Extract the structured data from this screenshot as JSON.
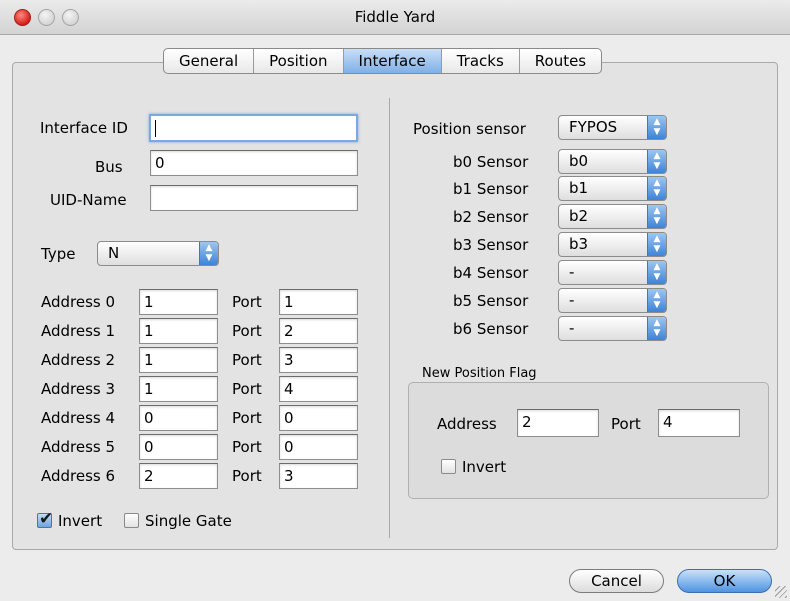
{
  "window": {
    "title": "Fiddle Yard"
  },
  "tabs": [
    "General",
    "Position",
    "Interface",
    "Tracks",
    "Routes"
  ],
  "active_tab": "Interface",
  "left": {
    "interface_id_label": "Interface ID",
    "interface_id_value": "",
    "bus_label": "Bus",
    "bus_value": "0",
    "uid_label": "UID-Name",
    "uid_value": "",
    "type_label": "Type",
    "type_value": "N",
    "port_label": "Port",
    "addresses": [
      {
        "label": "Address 0",
        "address": "1",
        "port": "1"
      },
      {
        "label": "Address 1",
        "address": "1",
        "port": "2"
      },
      {
        "label": "Address 2",
        "address": "1",
        "port": "3"
      },
      {
        "label": "Address 3",
        "address": "1",
        "port": "4"
      },
      {
        "label": "Address 4",
        "address": "0",
        "port": "0"
      },
      {
        "label": "Address 5",
        "address": "0",
        "port": "0"
      },
      {
        "label": "Address 6",
        "address": "2",
        "port": "3"
      }
    ],
    "invert_label": "Invert",
    "invert_checked": true,
    "single_gate_label": "Single Gate",
    "single_gate_checked": false
  },
  "right": {
    "position_sensor_label": "Position sensor",
    "position_sensor_value": "FYPOS",
    "sensors": [
      {
        "label": "b0 Sensor",
        "value": "b0"
      },
      {
        "label": "b1 Sensor",
        "value": "b1"
      },
      {
        "label": "b2 Sensor",
        "value": "b2"
      },
      {
        "label": "b3 Sensor",
        "value": "b3"
      },
      {
        "label": "b4 Sensor",
        "value": "-"
      },
      {
        "label": "b5 Sensor",
        "value": "-"
      },
      {
        "label": "b6 Sensor",
        "value": "-"
      }
    ],
    "new_position_flag": {
      "title": "New Position Flag",
      "address_label": "Address",
      "address_value": "2",
      "port_label": "Port",
      "port_value": "4",
      "invert_label": "Invert",
      "invert_checked": false
    }
  },
  "buttons": {
    "cancel": "Cancel",
    "ok": "OK"
  },
  "colors": {
    "accent": "#6fa4e0",
    "tab_active": "#a9c9ee"
  }
}
